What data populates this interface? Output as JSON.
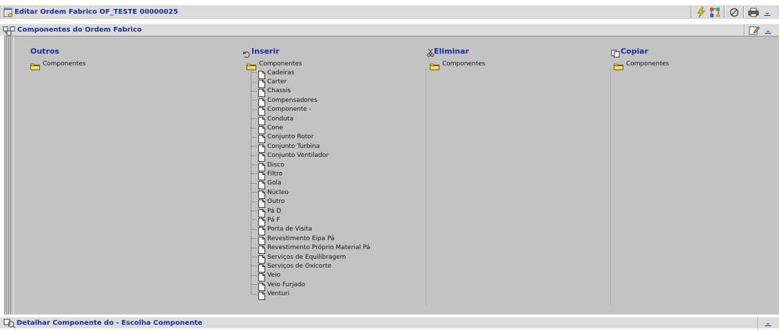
{
  "window": {
    "title": "Editar Ordem Fabrico  OF_TESTE  00000025",
    "collapse_glyph": "⌄"
  },
  "section": {
    "title": "Componentes do Ordem Fabrico",
    "collapse_glyph": "⌄"
  },
  "footer": {
    "title": "Detalhar Componente do  - Escolha Componente",
    "collapse_glyph": "⌄"
  },
  "colors": {
    "title_blue": "#1a2f9e",
    "panel_bg": "#c3c3c3",
    "bar_bg": "#dcdcdc",
    "folder_yellow": "#f3dc5a"
  },
  "columns": {
    "outros": {
      "title": "Outros",
      "root": "Componentes"
    },
    "inserir": {
      "title": "Inserir",
      "icon": "undo-icon",
      "root": "Componentes",
      "items": [
        "Cadeiras",
        "Carter",
        "Chassis",
        "Compensadores",
        "Componente -",
        "Conduta",
        "Cone",
        "Conjunto Rotor",
        "Conjunto Turbina",
        "Conjunto Ventilador",
        "Disco",
        "Filtro",
        "Gola",
        "Núcleo",
        "Outro",
        "Pá D",
        "Pá F",
        "Porta de Visita",
        "Revestimento Eipa Pá",
        "Revestimento Próprio Material Pá",
        "Serviços de Equilibragem",
        "Serviços de Oxicorte",
        "Veio",
        "Veio Furjado",
        "Venturi"
      ]
    },
    "eliminar": {
      "title": "Eliminar",
      "icon": "scissors-icon",
      "root": "Componentes"
    },
    "copiar": {
      "title": "Copiar",
      "icon": "copy-icon",
      "root": "Componentes"
    }
  }
}
